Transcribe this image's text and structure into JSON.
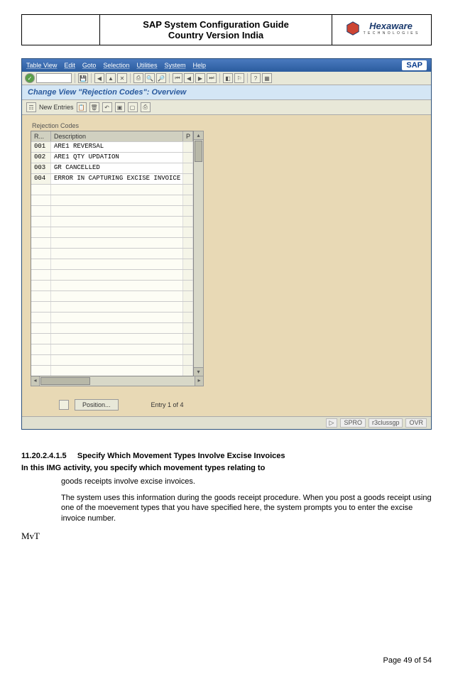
{
  "header": {
    "title_line1": "SAP System Configuration Guide",
    "title_line2": "Country Version India",
    "logo_name": "Hexaware",
    "logo_sub": "T E C H N O L O G I E S"
  },
  "sap": {
    "menu": [
      "Table View",
      "Edit",
      "Goto",
      "Selection",
      "Utilities",
      "System",
      "Help"
    ],
    "logo": "SAP",
    "subtitle": "Change View \"Rejection Codes\": Overview",
    "subtoolbar_label": "New Entries",
    "panel_title": "Rejection Codes",
    "columns": {
      "a": "R...",
      "b": "Description",
      "c": "P"
    },
    "rows": [
      {
        "code": "001",
        "desc": "ARE1 REVERSAL"
      },
      {
        "code": "002",
        "desc": "ARE1 QTY UPDATION"
      },
      {
        "code": "003",
        "desc": "GR CANCELLED"
      },
      {
        "code": "004",
        "desc": "ERROR IN CAPTURING EXCISE INVOICE"
      }
    ],
    "empty_rows": 18,
    "nav_position": "Position...",
    "nav_entry": "Entry 1 of 4",
    "status": {
      "tcode": "SPRO",
      "server": "r3clussgp",
      "mode": "OVR",
      "arrow": "▷"
    }
  },
  "doc": {
    "heading_num": "11.20.2.4.1.5",
    "heading_text": "Specify Which Movement Types Involve Excise Invoices",
    "line2": "In this IMG activity, you specify which movement types relating to",
    "para1": "goods receipts involve excise invoices.",
    "para2": "The system uses this information during the goods receipt procedure. When you post a goods receipt using one of the moevement types that you have specified here, the system prompts you to enter the excise invoice number.",
    "mvt": "MvT"
  },
  "footer": "Page 49 of 54"
}
